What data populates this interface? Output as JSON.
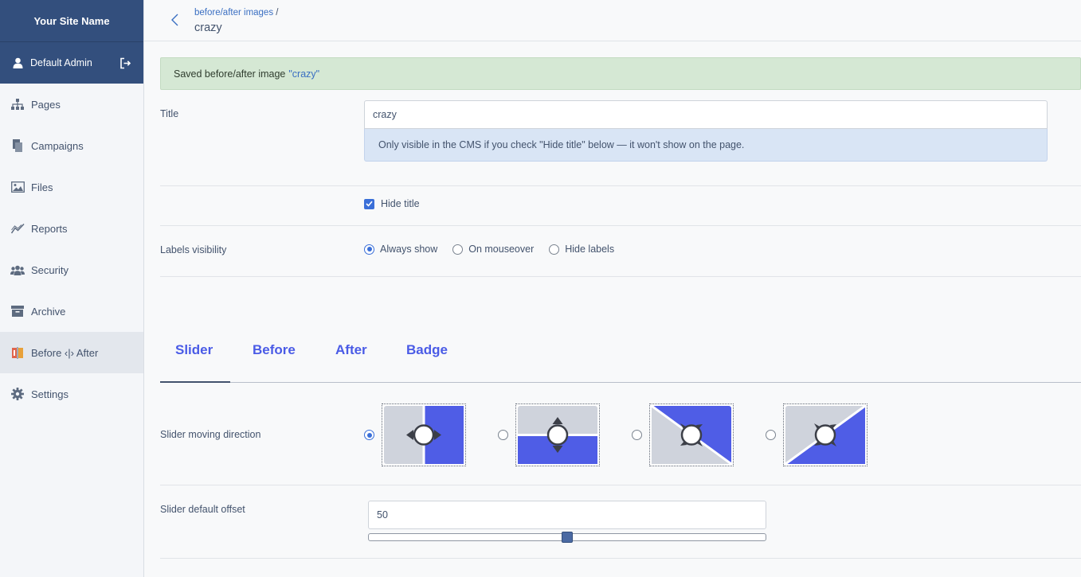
{
  "sidebar": {
    "site_name": "Your Site Name",
    "user": "Default Admin",
    "items": [
      {
        "label": "Pages",
        "icon": "sitemap-icon"
      },
      {
        "label": "Campaigns",
        "icon": "copy-icon"
      },
      {
        "label": "Files",
        "icon": "image-icon"
      },
      {
        "label": "Reports",
        "icon": "chart-line-icon"
      },
      {
        "label": "Security",
        "icon": "users-icon"
      },
      {
        "label": "Archive",
        "icon": "archive-icon"
      },
      {
        "label": "Before ‹|› After",
        "icon": "before-after-icon"
      },
      {
        "label": "Settings",
        "icon": "gear-icon"
      }
    ],
    "active_index": 6
  },
  "header": {
    "breadcrumb_link": "before/after images",
    "breadcrumb_sep": "/",
    "title": "crazy"
  },
  "alert": {
    "prefix": "Saved before/after image",
    "name": "\"crazy\""
  },
  "form": {
    "title_label": "Title",
    "title_value": "crazy",
    "title_help": "Only visible in the CMS if you check \"Hide title\" below — it won't show on the page.",
    "hide_title_label": "Hide title",
    "hide_title_checked": true,
    "labels_visibility_label": "Labels visibility",
    "labels_options": [
      "Always show",
      "On mouseover",
      "Hide labels"
    ],
    "labels_selected": 0
  },
  "tabs": [
    "Slider",
    "Before",
    "After",
    "Badge"
  ],
  "active_tab": 0,
  "slider": {
    "direction_label": "Slider moving direction",
    "direction_options": [
      "horizontal",
      "vertical",
      "diagonal-down",
      "diagonal-up"
    ],
    "direction_selected": 0,
    "offset_label": "Slider default offset",
    "offset_value": "50",
    "offset_fraction": 0.5
  },
  "colors": {
    "sidebar_header": "#334f7d",
    "accent": "#4a5be6",
    "alert_bg": "#d5e8d4",
    "help_bg": "#d9e5f5",
    "thumb_before": "#cfd3dc",
    "thumb_after": "#4f5de6"
  }
}
